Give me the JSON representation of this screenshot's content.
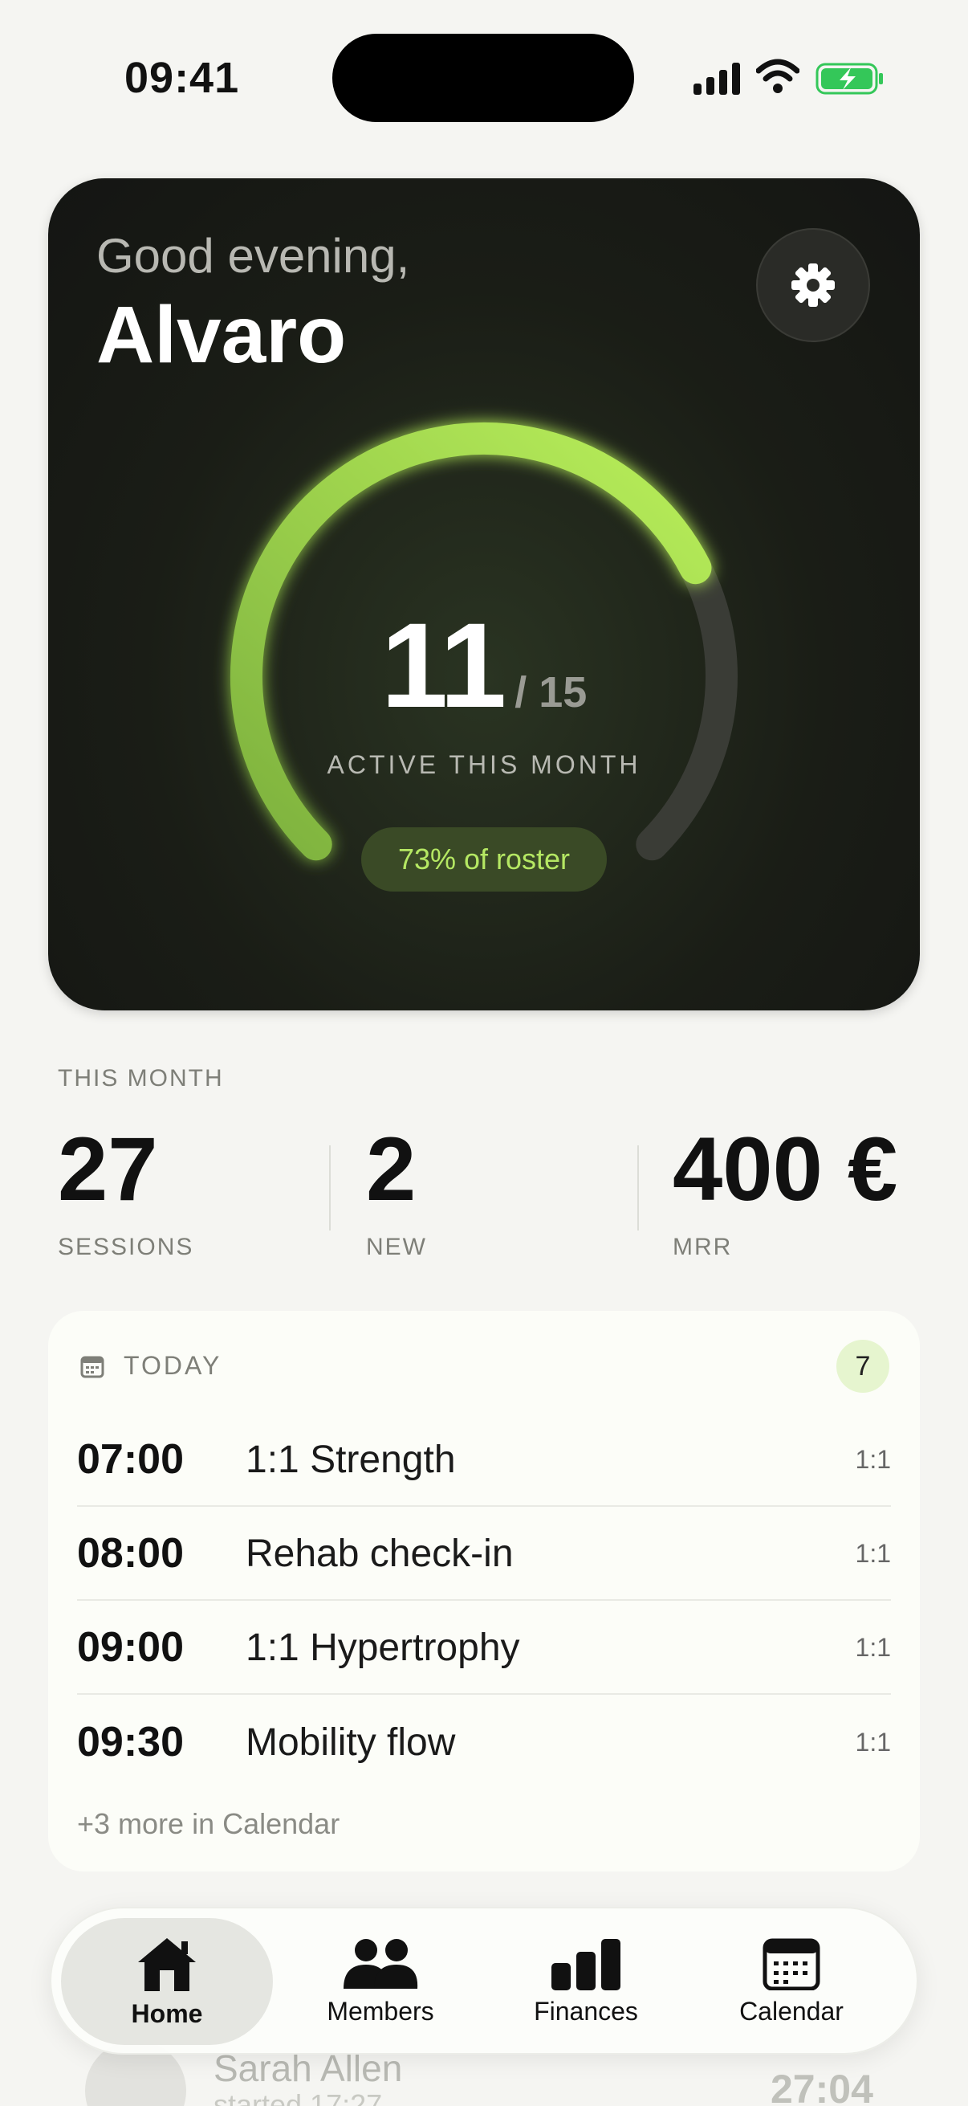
{
  "status_bar": {
    "time": "09:41"
  },
  "hero": {
    "greeting": "Good evening,",
    "name": "Alvaro",
    "active_count": "11",
    "total_count": "/ 15",
    "caption": "ACTIVE THIS MONTH",
    "roster_pill": "73% of roster",
    "progress_fraction": 0.733,
    "accent_color": "#b5e863"
  },
  "stats": {
    "section_label": "THIS MONTH",
    "items": [
      {
        "value": "27",
        "label": "SESSIONS"
      },
      {
        "value": "2",
        "label": "NEW"
      },
      {
        "value": "400 €",
        "label": "MRR"
      }
    ]
  },
  "today": {
    "label": "TODAY",
    "count": "7",
    "sessions": [
      {
        "time": "07:00",
        "title": "1:1 Strength",
        "type": "1:1"
      },
      {
        "time": "08:00",
        "title": "Rehab check-in",
        "type": "1:1"
      },
      {
        "time": "09:00",
        "title": "1:1 Hypertrophy",
        "type": "1:1"
      },
      {
        "time": "09:30",
        "title": "Mobility flow",
        "type": "1:1"
      }
    ],
    "more_link": "+3 more in Calendar"
  },
  "peek": {
    "name": "Sarah Allen",
    "subtitle": "started 17:27",
    "timer": "27:04"
  },
  "tabbar": {
    "tabs": [
      {
        "label": "Home",
        "icon": "house-icon",
        "active": true
      },
      {
        "label": "Members",
        "icon": "people-icon",
        "active": false
      },
      {
        "label": "Finances",
        "icon": "bar-chart-icon",
        "active": false
      },
      {
        "label": "Calendar",
        "icon": "calendar-icon",
        "active": false
      }
    ]
  }
}
